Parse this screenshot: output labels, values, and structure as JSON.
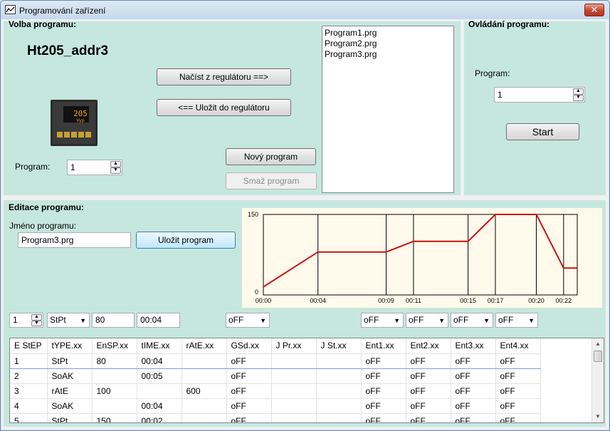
{
  "window": {
    "title": "Programování zařízení",
    "close_glyph": "✕"
  },
  "volba": {
    "label": "Volba programu:",
    "device_name": "Ht205_addr3",
    "device_display": "205",
    "device_display_sub": "Vyp",
    "program_label": "Program:",
    "program_value": "1",
    "load_button": "Načíst z regulátoru ==>",
    "save_button": "<== Uložit do regulátoru",
    "new_button": "Nový program",
    "delete_button": "Smaž program",
    "files": [
      "Program1.prg",
      "Program2.prg",
      "Program3.prg"
    ]
  },
  "ovladani": {
    "label": "Ovládání programu:",
    "program_label": "Program:",
    "program_value": "1",
    "start_button": "Start"
  },
  "editace": {
    "label": "Editace programu:",
    "name_label": "Jméno programu:",
    "name_value": "Program3.prg",
    "save_button": "Uložit program",
    "editor_row": {
      "step": "1",
      "type": "StPt",
      "ensp": "80",
      "time": "00:04",
      "gsd": "oFF",
      "ent1": "oFF",
      "ent2": "oFF",
      "ent3": "oFF",
      "ent4": "oFF"
    }
  },
  "chart_data": {
    "type": "line",
    "x": [
      "00:00",
      "00:04",
      "00:09",
      "00:11",
      "00:15",
      "00:17",
      "00:20",
      "00:22",
      "00:23"
    ],
    "tick_labels": [
      "00:00",
      "00:04",
      "00:09",
      "00:11",
      "00:15",
      "00:17",
      "00:20",
      "00:22"
    ],
    "series": [
      {
        "values": [
          15,
          80,
          80,
          100,
          100,
          150,
          150,
          50,
          50
        ]
      }
    ],
    "ylim": [
      0,
      150
    ],
    "y_ticks": [
      "150",
      "0"
    ],
    "line_color": "#cc1111",
    "grid": "vertical lines at step boundaries"
  },
  "table": {
    "columns": [
      "E StEP",
      "tYPE.xx",
      "EnSP.xx",
      "tIME.xx",
      "rAtE.xx",
      "GSd.xx",
      "J Pr.xx",
      "J St.xx",
      "Ent1.xx",
      "Ent2.xx",
      "Ent3.xx",
      "Ent4.xx"
    ],
    "rows": [
      [
        "1",
        "StPt",
        "80",
        "00:04",
        "",
        "oFF",
        "",
        "",
        "oFF",
        "oFF",
        "oFF",
        "oFF"
      ],
      [
        "2",
        "SoAK",
        "",
        "00:05",
        "",
        "oFF",
        "",
        "",
        "oFF",
        "oFF",
        "oFF",
        "oFF"
      ],
      [
        "3",
        "rAtE",
        "100",
        "",
        "600",
        "oFF",
        "",
        "",
        "oFF",
        "oFF",
        "oFF",
        "oFF"
      ],
      [
        "4",
        "SoAK",
        "",
        "00:04",
        "",
        "oFF",
        "",
        "",
        "oFF",
        "oFF",
        "oFF",
        "oFF"
      ],
      [
        "5",
        "StPt",
        "150",
        "00:02",
        "",
        "oFF",
        "",
        "",
        "oFF",
        "oFF",
        "oFF",
        "oFF"
      ]
    ]
  }
}
